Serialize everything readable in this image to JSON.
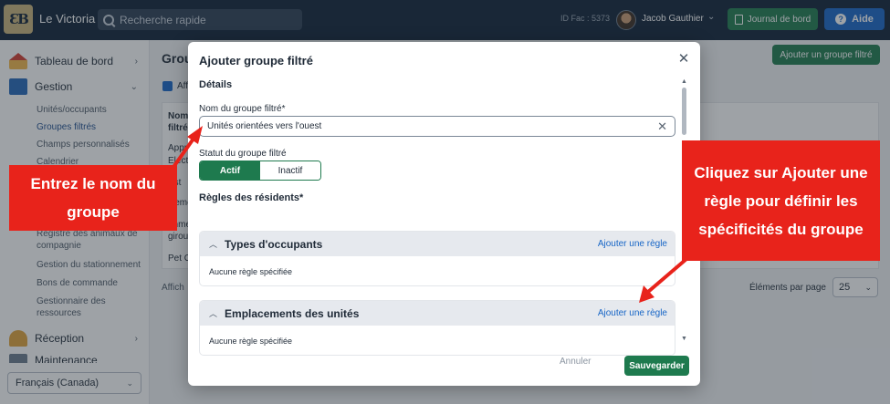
{
  "topbar": {
    "app_name": "Le Victoria",
    "search_placeholder": "Recherche rapide",
    "id_fac": "ID Fac : 5373",
    "user_name": "Jacob Gauthier",
    "journal_label": "Journal de bord",
    "aide_label": "Aide"
  },
  "sidebar": {
    "tableau": "Tableau de bord",
    "gestion": "Gestion",
    "sub_items": [
      "Unités/occupants",
      "Groupes filtrés",
      "Champs personnalisés",
      "Calendrier",
      "Registre des animaux de compagnie",
      "Gestion du stationnement",
      "Bons de commande",
      "Gestionnaire des ressources"
    ],
    "reception": "Réception",
    "maintenance": "Maintenance",
    "language": "Français (Canada)"
  },
  "background": {
    "title": "Group",
    "checkbox_label": "Aff",
    "add_button": "Ajouter un groupe filtré",
    "col_head": "Nom filtré",
    "rows": [
      "Appr",
      "Electr",
      "Est",
      "Heme",
      "Imme",
      "giroux",
      "Pet O"
    ],
    "footer": "Affich",
    "per_page_label": "Éléments par page",
    "per_page_value": "25"
  },
  "modal": {
    "title": "Ajouter groupe filtré",
    "details": "Détails",
    "name_label": "Nom du groupe filtré*",
    "name_value": "Unités orientées vers l'ouest",
    "status_label": "Statut du groupe filtré",
    "active": "Actif",
    "inactive": "Inactif",
    "rules_label": "Règles des résidents*",
    "panels": [
      {
        "title": "Types d'occupants",
        "link": "Ajouter une règle",
        "body": "Aucune règle spécifiée"
      },
      {
        "title": "Emplacements des unités",
        "link": "Ajouter une règle",
        "body": "Aucune règle spécifiée"
      }
    ],
    "cancel": "Annuler",
    "save": "Sauvegarder"
  },
  "callouts": {
    "left": "Entrez le nom du groupe",
    "right": "Cliquez sur Ajouter une règle pour définir les spécificités du groupe"
  },
  "colors": {
    "topbar": "#0e2035",
    "green": "#1e7a4e",
    "blue": "#1665c6",
    "callout_red": "#e8231b"
  }
}
